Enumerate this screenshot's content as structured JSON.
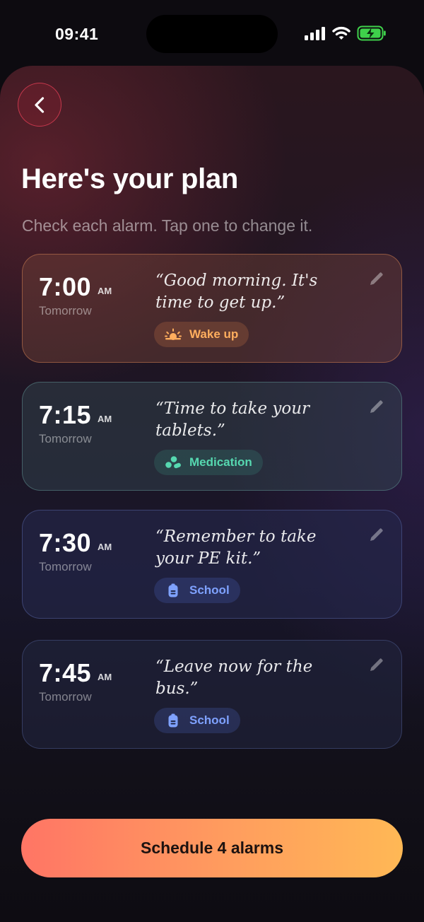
{
  "status_bar": {
    "time": "09:41"
  },
  "header": {
    "back_icon": "chevron-left-icon",
    "title": "Here's your plan",
    "subtitle": "Check each alarm. Tap one to change it."
  },
  "alarms": [
    {
      "time": "7:00",
      "period": "AM",
      "day": "Tomorrow",
      "message": "“Good morning. It's time to get up.”",
      "tag": "Wake up",
      "tag_icon": "sunrise-icon",
      "tag_color": "#ffae5e"
    },
    {
      "time": "7:15",
      "period": "AM",
      "day": "Tomorrow",
      "message": "“Time to take your tablets.”",
      "tag": "Medication",
      "tag_icon": "pills-icon",
      "tag_color": "#56d8b0"
    },
    {
      "time": "7:30",
      "period": "AM",
      "day": "Tomorrow",
      "message": "“Remember to take your PE kit.”",
      "tag": "School",
      "tag_icon": "backpack-icon",
      "tag_color": "#7fa2ff"
    },
    {
      "time": "7:45",
      "period": "AM",
      "day": "Tomorrow",
      "message": "“Leave now for the bus.”",
      "tag": "School",
      "tag_icon": "backpack-icon",
      "tag_color": "#7fa2ff"
    }
  ],
  "footer": {
    "schedule_label": "Schedule 4 alarms"
  },
  "colors": {
    "accent_gradient": [
      "#ff7565",
      "#ffb855"
    ],
    "back_ring": "#e84058"
  }
}
